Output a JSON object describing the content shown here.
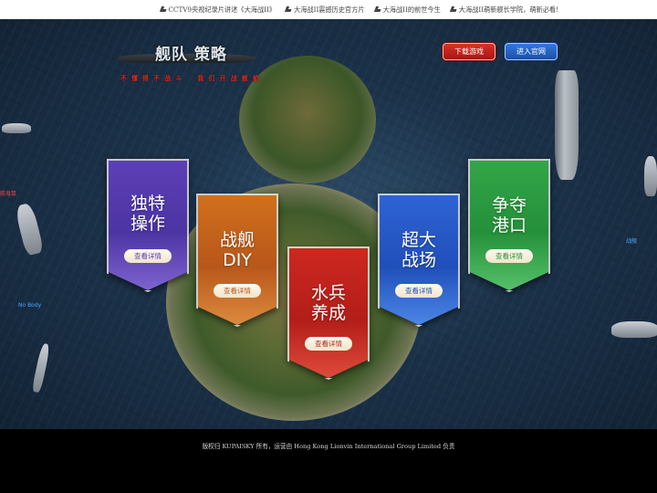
{
  "news": [
    {
      "text": "CCTV9央视纪录片讲述《大海战II》"
    },
    {
      "text": "大海战II震撼历史官方片"
    },
    {
      "text": "大海战II的前世今生"
    },
    {
      "text": "大海战II萌新舰长学院，萌新必看!"
    }
  ],
  "logo": {
    "title": "舰队 策略",
    "slogan": "不 懂 得 不 战 斗 　 我 们 开 战 舰 航"
  },
  "buttons": {
    "download": "下载游戏",
    "official_site": "进入官网"
  },
  "features": [
    {
      "line1": "独特",
      "line2": "操作",
      "more": "查看详情",
      "color": "#4c34a3"
    },
    {
      "line1": "战舰",
      "line2": "DIY",
      "more": "查看详情",
      "color": "#b8571a"
    },
    {
      "line1": "水兵",
      "line2": "养成",
      "more": "查看详情",
      "color": "#b21e18"
    },
    {
      "line1": "超大",
      "line2": "战场",
      "more": "查看详情",
      "color": "#1f4fb9"
    },
    {
      "line1": "争夺",
      "line2": "港口",
      "more": "查看详情",
      "color": "#24903a"
    }
  ],
  "units": [
    {
      "name": "No Body",
      "color": "#4aa3ff"
    },
    {
      "name": "航母鼠",
      "color": "#ff4040"
    },
    {
      "name": "战舰",
      "color": "#4aa3ff"
    }
  ],
  "footer": {
    "copyright": "版权归 KUPAISKY 所有，运营由 Hong Kong Lionvin International Group Limited 负责"
  }
}
